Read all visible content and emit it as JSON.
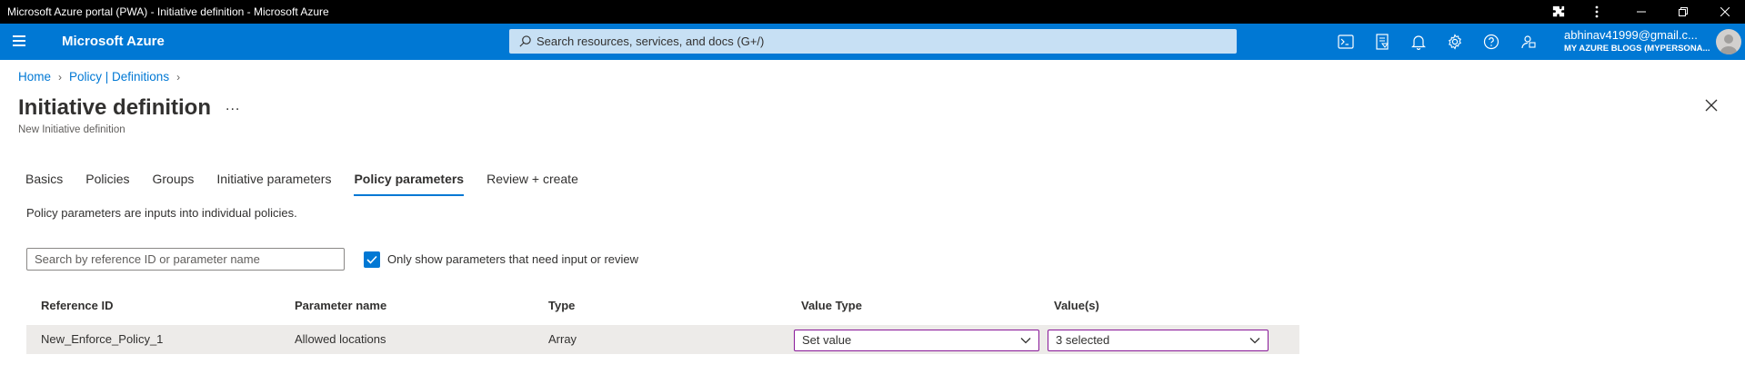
{
  "window": {
    "title": "Microsoft Azure portal (PWA) - Initiative definition - Microsoft Azure"
  },
  "topbar": {
    "brand": "Microsoft Azure",
    "search_placeholder": "Search resources, services, and docs (G+/)",
    "account_email": "abhinav41999@gmail.c...",
    "account_directory": "MY AZURE BLOGS (MYPERSONA...",
    "icons": [
      "cloud-shell-icon",
      "directory-filter-icon",
      "notifications-icon",
      "settings-icon",
      "help-icon",
      "feedback-icon"
    ],
    "accent_color": "#0078d4"
  },
  "breadcrumb": {
    "items": [
      "Home",
      "Policy | Definitions"
    ]
  },
  "header": {
    "title": "Initiative definition",
    "more": "...",
    "subtitle": "New Initiative definition"
  },
  "tabs": [
    {
      "label": "Basics",
      "active": false
    },
    {
      "label": "Policies",
      "active": false
    },
    {
      "label": "Groups",
      "active": false
    },
    {
      "label": "Initiative parameters",
      "active": false
    },
    {
      "label": "Policy parameters",
      "active": true
    },
    {
      "label": "Review + create",
      "active": false
    }
  ],
  "content": {
    "description": "Policy parameters are inputs into individual policies.",
    "search_placeholder": "Search by reference ID or parameter name",
    "checkbox_label": "Only show parameters that need input or review",
    "checkbox_checked": true
  },
  "table": {
    "columns": [
      "Reference ID",
      "Parameter name",
      "Type",
      "Value Type",
      "Value(s)"
    ],
    "rows": [
      {
        "reference_id": "New_Enforce_Policy_1",
        "parameter_name": "Allowed locations",
        "type": "Array",
        "value_type": "Set value",
        "values": "3 selected"
      }
    ]
  }
}
